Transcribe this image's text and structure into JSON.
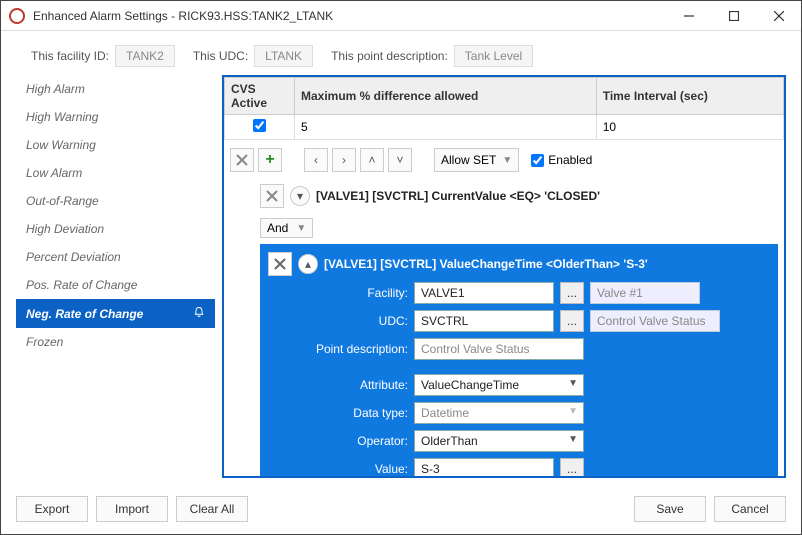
{
  "titlebar": {
    "title": "Enhanced Alarm Settings - RICK93.HSS:TANK2_LTANK"
  },
  "toprow": {
    "facility_lbl": "This facility ID:",
    "facility_val": "TANK2",
    "udc_lbl": "This UDC:",
    "udc_val": "LTANK",
    "desc_lbl": "This point description:",
    "desc_val": "Tank Level"
  },
  "sidebar": [
    "High Alarm",
    "High Warning",
    "Low Warning",
    "Low Alarm",
    "Out-of-Range",
    "High Deviation",
    "Percent Deviation",
    "Pos. Rate of Change",
    "Neg. Rate of Change",
    "Frozen"
  ],
  "grid": {
    "headers": {
      "c1": "CVS Active",
      "c2": "Maximum % difference allowed",
      "c3": "Time Interval (sec)"
    },
    "row": {
      "active": true,
      "max_pct": "5",
      "interval": "10"
    }
  },
  "toolbar": {
    "allow_label": "Allow SET",
    "enabled_label": "Enabled",
    "enabled": true
  },
  "rule1_text": "[VALVE1] [SVCTRL] CurrentValue <EQ> 'CLOSED'",
  "logic_op": "And",
  "rule2_text": "[VALVE1] [SVCTRL] ValueChangeTime <OlderThan> 'S-3'",
  "form": {
    "labels": {
      "facility": "Facility:",
      "udc": "UDC:",
      "pointdesc": "Point description:",
      "attribute": "Attribute:",
      "datatype": "Data type:",
      "operator": "Operator:",
      "value": "Value:"
    },
    "facility": "VALVE1",
    "facility_desc": "Valve #1",
    "udc": "SVCTRL",
    "udc_desc": "Control Valve Status",
    "pointdesc": "Control Valve Status",
    "attribute": "ValueChangeTime",
    "datatype": "Datetime",
    "operator": "OlderThan",
    "value": "S-3"
  },
  "footer": {
    "export": "Export",
    "import": "Import",
    "clear": "Clear All",
    "save": "Save",
    "cancel": "Cancel"
  }
}
